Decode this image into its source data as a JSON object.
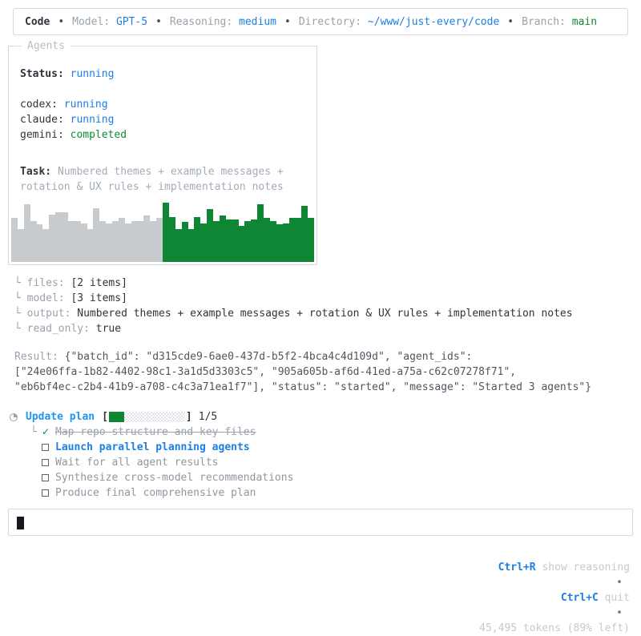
{
  "topbar": {
    "app": "Code",
    "separator": "•",
    "model_label": "Model:",
    "model_value": "GPT-5",
    "reasoning_label": "Reasoning:",
    "reasoning_value": "medium",
    "directory_label": "Directory:",
    "directory_value": "~/www/just-every/code",
    "branch_label": "Branch:",
    "branch_value": "main"
  },
  "agents_panel": {
    "title": "Agents",
    "status_label": "Status:",
    "status_value": "running",
    "agents": [
      {
        "name": "codex:",
        "state": "running",
        "color": "#1b7fe4"
      },
      {
        "name": "claude:",
        "state": "running",
        "color": "#1b7fe4"
      },
      {
        "name": "gemini:",
        "state": "completed",
        "color": "#0e8a38"
      }
    ],
    "task_label": "Task:",
    "task_value": "Numbered themes + example messages + rotation & UX rules + implementation notes",
    "activity_chart": {
      "type": "bar",
      "values": [
        70,
        52,
        92,
        66,
        60,
        52,
        76,
        80,
        80,
        66,
        66,
        62,
        52,
        86,
        66,
        62,
        66,
        70,
        62,
        66,
        66,
        74,
        66,
        70,
        95,
        72,
        52,
        64,
        52,
        72,
        62,
        85,
        66,
        74,
        68,
        68,
        58,
        66,
        68,
        92,
        70,
        66,
        60,
        62,
        70,
        70,
        90,
        70
      ],
      "active_start_index": 24,
      "colors": {
        "past": "#c8cbce",
        "active": "#0f8634"
      }
    }
  },
  "params": [
    {
      "key": "└ files: ",
      "value": "[2 items]"
    },
    {
      "key": "└ model: ",
      "value": "[3 items]"
    },
    {
      "key": "└ output: ",
      "value": "Numbered themes + example messages + rotation & UX rules + implementation notes"
    },
    {
      "key": "└ read_only: ",
      "value": "true"
    }
  ],
  "result": {
    "label": "Result: ",
    "lines": [
      "{\"batch_id\": \"d315cde9-6ae0-437d-b5f2-4bca4c4d109d\", \"agent_ids\":",
      "[\"24e06ffa-1b82-4402-98c1-3a1d5d3303c5\", \"905a605b-af6d-41ed-a75a-c62c07278f71\",",
      "\"eb6bf4ec-c2b4-41b9-a708-c4c3a71ea1f7\"], \"status\": \"started\", \"message\": \"Started 3 agents\"}"
    ]
  },
  "plan": {
    "title": "Update plan",
    "progress": {
      "completed": 1,
      "total": 5,
      "label": "1/5",
      "open_bracket": "[",
      "close_bracket": "]"
    },
    "items": [
      {
        "label": "Map repo structure and key files",
        "status": "done"
      },
      {
        "label": "Launch parallel planning agents",
        "status": "current"
      },
      {
        "label": "Wait for all agent results",
        "status": "pending"
      },
      {
        "label": "Synthesize cross-model recommendations",
        "status": "pending"
      },
      {
        "label": "Produce final comprehensive plan",
        "status": "pending"
      }
    ]
  },
  "composer": {
    "value": ""
  },
  "footer": {
    "shortcut1_key": "Ctrl+R",
    "shortcut1_label": " show reasoning",
    "shortcut2_key": "Ctrl+C",
    "shortcut2_label": " quit",
    "separator": "•",
    "tokens": "45,495 tokens (89% left)"
  }
}
